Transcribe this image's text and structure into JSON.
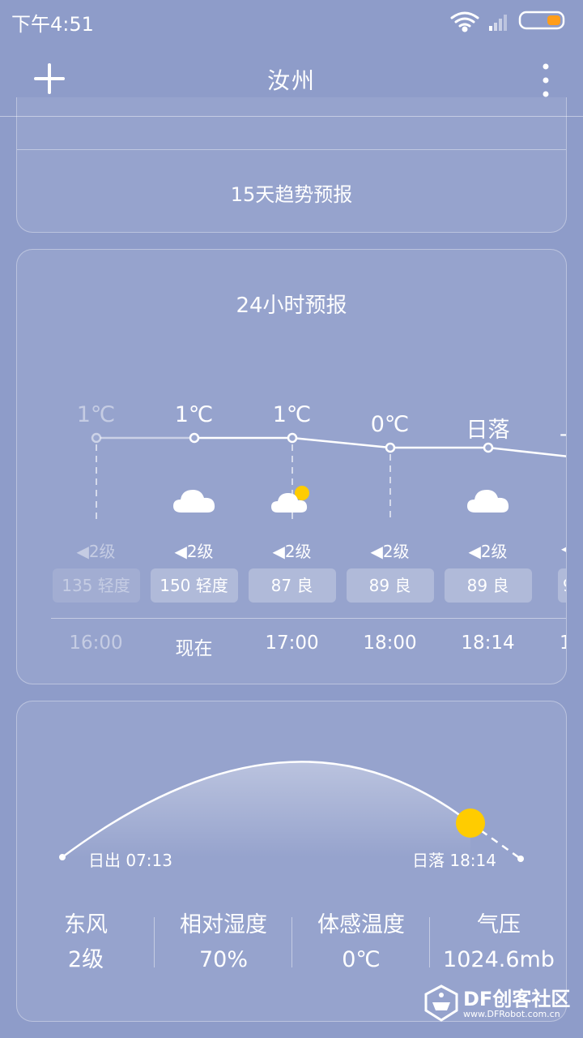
{
  "status_bar": {
    "time": "下午4:51"
  },
  "toolbar": {
    "city": "汝州"
  },
  "trend_card": {
    "label": "15天趋势预报"
  },
  "hourly": {
    "title": "24小时预报",
    "items": [
      {
        "temp": "1℃",
        "wind": "◀2级",
        "aqi": "135  轻度",
        "time": "16:00",
        "faded": true,
        "icon": "none"
      },
      {
        "temp": "1℃",
        "wind": "◀2级",
        "aqi": "150  轻度",
        "time": "现在",
        "faded": false,
        "icon": "cloud-icon"
      },
      {
        "temp": "1℃",
        "wind": "◀2级",
        "aqi": "87  良",
        "time": "17:00",
        "faded": false,
        "icon": "partly-cloudy-icon"
      },
      {
        "temp": "0℃",
        "wind": "◀2级",
        "aqi": "89  良",
        "time": "18:00",
        "faded": false,
        "icon": "none"
      },
      {
        "temp": "日落",
        "wind": "◀2级",
        "aqi": "89  良",
        "time": "18:14",
        "faded": false,
        "icon": "cloud-icon"
      },
      {
        "temp": "-",
        "wind": "◀",
        "aqi": "9",
        "time": "1",
        "faded": false,
        "icon": "none"
      }
    ]
  },
  "sun": {
    "sunrise": "日出 07:13",
    "sunset": "日落 18:14"
  },
  "stats": [
    {
      "label": "东风",
      "value": "2级"
    },
    {
      "label": "相对湿度",
      "value": "70%"
    },
    {
      "label": "体感温度",
      "value": "0℃"
    },
    {
      "label": "气压",
      "value": "1024.6mb"
    }
  ],
  "watermark": {
    "brand": "DF创客社区",
    "url": "www.DFRobot.com.cn"
  },
  "colors": {
    "background": "#8e9cc9",
    "sun": "#ffcc00",
    "battery": "#ff9d1a"
  }
}
